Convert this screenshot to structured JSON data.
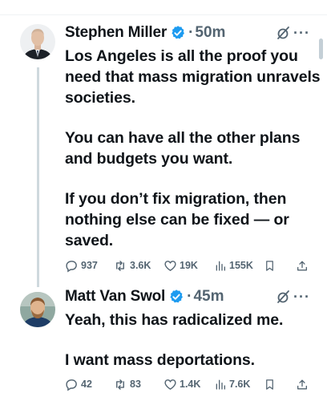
{
  "posts": [
    {
      "author": "Stephen Miller",
      "time": "50m",
      "paragraphs": [
        "Los Angeles is all the proof you need that mass migration unravels societies.",
        "You can have all the other plans and budgets you want.",
        "If you don’t fix migration, then nothing else can be fixed — or saved."
      ],
      "stats": {
        "replies": "937",
        "reposts": "3.6K",
        "likes": "19K",
        "views": "155K"
      }
    },
    {
      "author": "Matt Van Swol",
      "time": "45m",
      "paragraphs": [
        "Yeah, this has radicalized me.",
        "I want mass deportations."
      ],
      "stats": {
        "replies": "42",
        "reposts": "83",
        "likes": "1.4K",
        "views": "7.6K"
      }
    }
  ],
  "colors": {
    "verified": "#1d9bf0",
    "muted_text": "#536471",
    "thread_line": "#cfd9de"
  }
}
